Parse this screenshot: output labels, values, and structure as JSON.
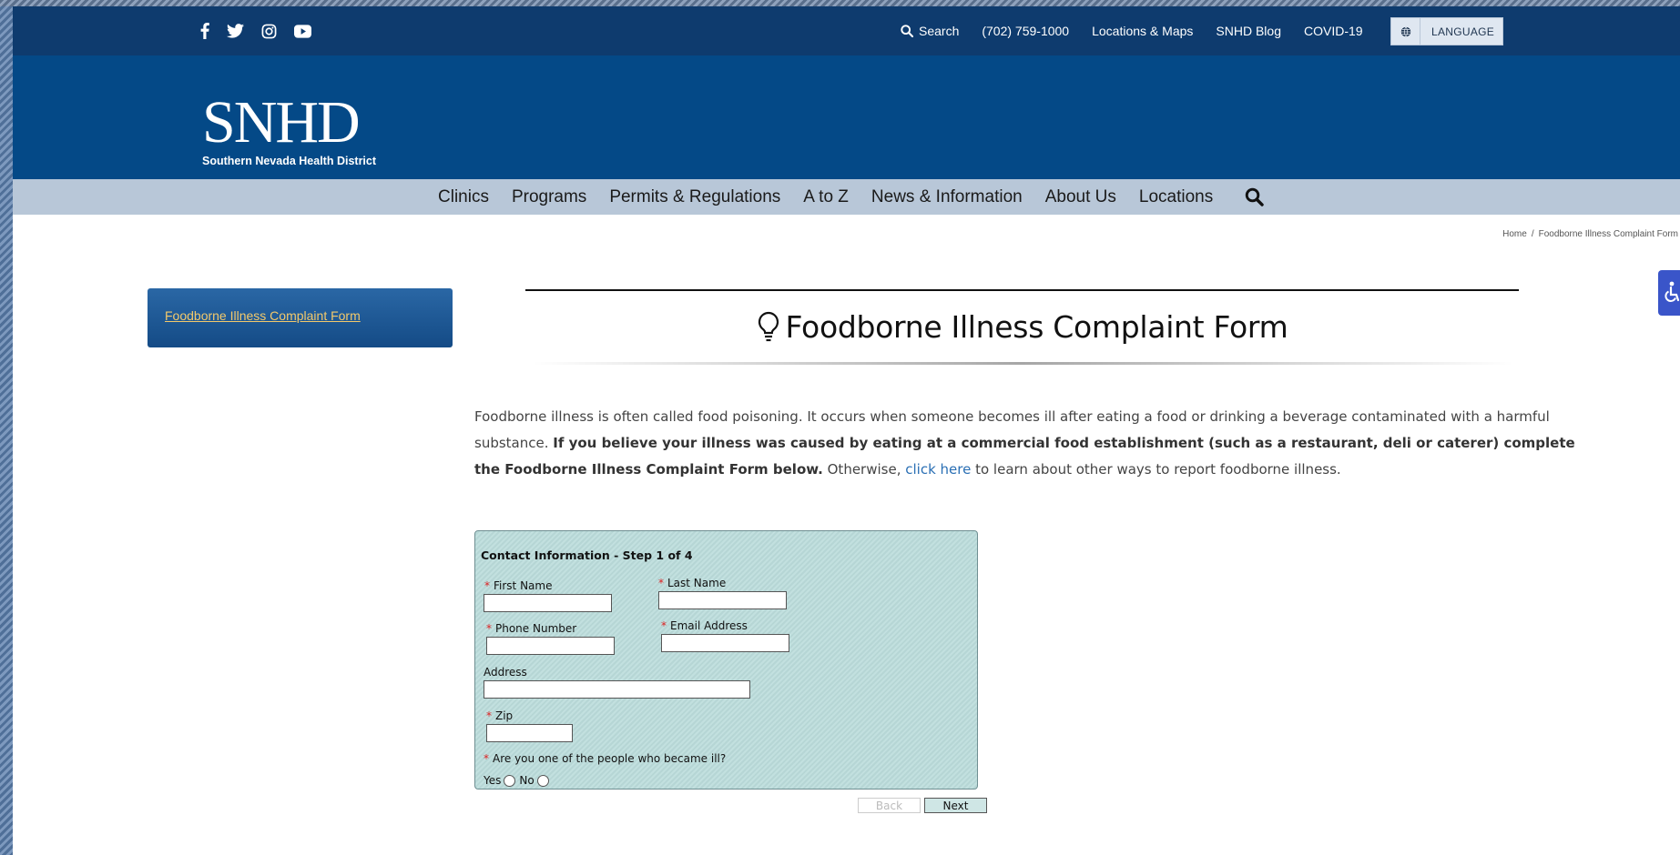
{
  "topbar": {
    "social": [
      "facebook-icon",
      "twitter-icon",
      "instagram-icon",
      "youtube-icon"
    ],
    "search_label": "Search",
    "phone": "(702) 759-1000",
    "locations": "Locations & Maps",
    "blog": "SNHD Blog",
    "covid": "COVID-19",
    "language": "LANGUAGE"
  },
  "logo": {
    "letters": "SNHD",
    "tagline": "Southern Nevada Health District"
  },
  "nav": {
    "items": [
      "Clinics",
      "Programs",
      "Permits & Regulations",
      "A to Z",
      "News & Information",
      "About Us",
      "Locations"
    ]
  },
  "breadcrumb": {
    "home": "Home",
    "separator": "/",
    "current": "Foodborne Illness Complaint Form"
  },
  "sidebar": {
    "link": "Foodborne Illness Complaint Form"
  },
  "page": {
    "title": "Foodborne Illness Complaint Form",
    "intro_part1": "Foodborne illness is often called food poisoning. It occurs when someone becomes ill after eating a food or drinking a beverage contaminated with a harmful substance. ",
    "intro_bold": "If you believe your illness was caused by eating at a commercial food establishment (such as a restaurant, deli or caterer) complete the Foodborne Illness Complaint Form below.",
    "intro_part2": " Otherwise, ",
    "intro_link": "click here",
    "intro_part3": " to learn about other ways to report foodborne illness."
  },
  "form": {
    "step": "Contact Information - Step 1 of 4",
    "required_mark": "*",
    "first_name_label": "First Name",
    "first_name_value": "",
    "last_name_label": "Last Name",
    "last_name_value": "",
    "phone_label": "Phone Number",
    "phone_value": "",
    "email_label": "Email Address",
    "email_value": "",
    "address_label": "Address",
    "address_value": "",
    "zip_label": "Zip",
    "zip_value": "",
    "ill_question": "Are you one of the people who became ill?",
    "yes_label": "Yes",
    "no_label": "No",
    "back_label": "Back",
    "next_label": "Next"
  },
  "colors": {
    "topbar": "#0e3b6e",
    "header": "#044987",
    "nav": "#b8c7d8",
    "form_bg": "#c2e0df",
    "link": "#2a6fb4",
    "sidebar_link": "#f3c96b"
  }
}
